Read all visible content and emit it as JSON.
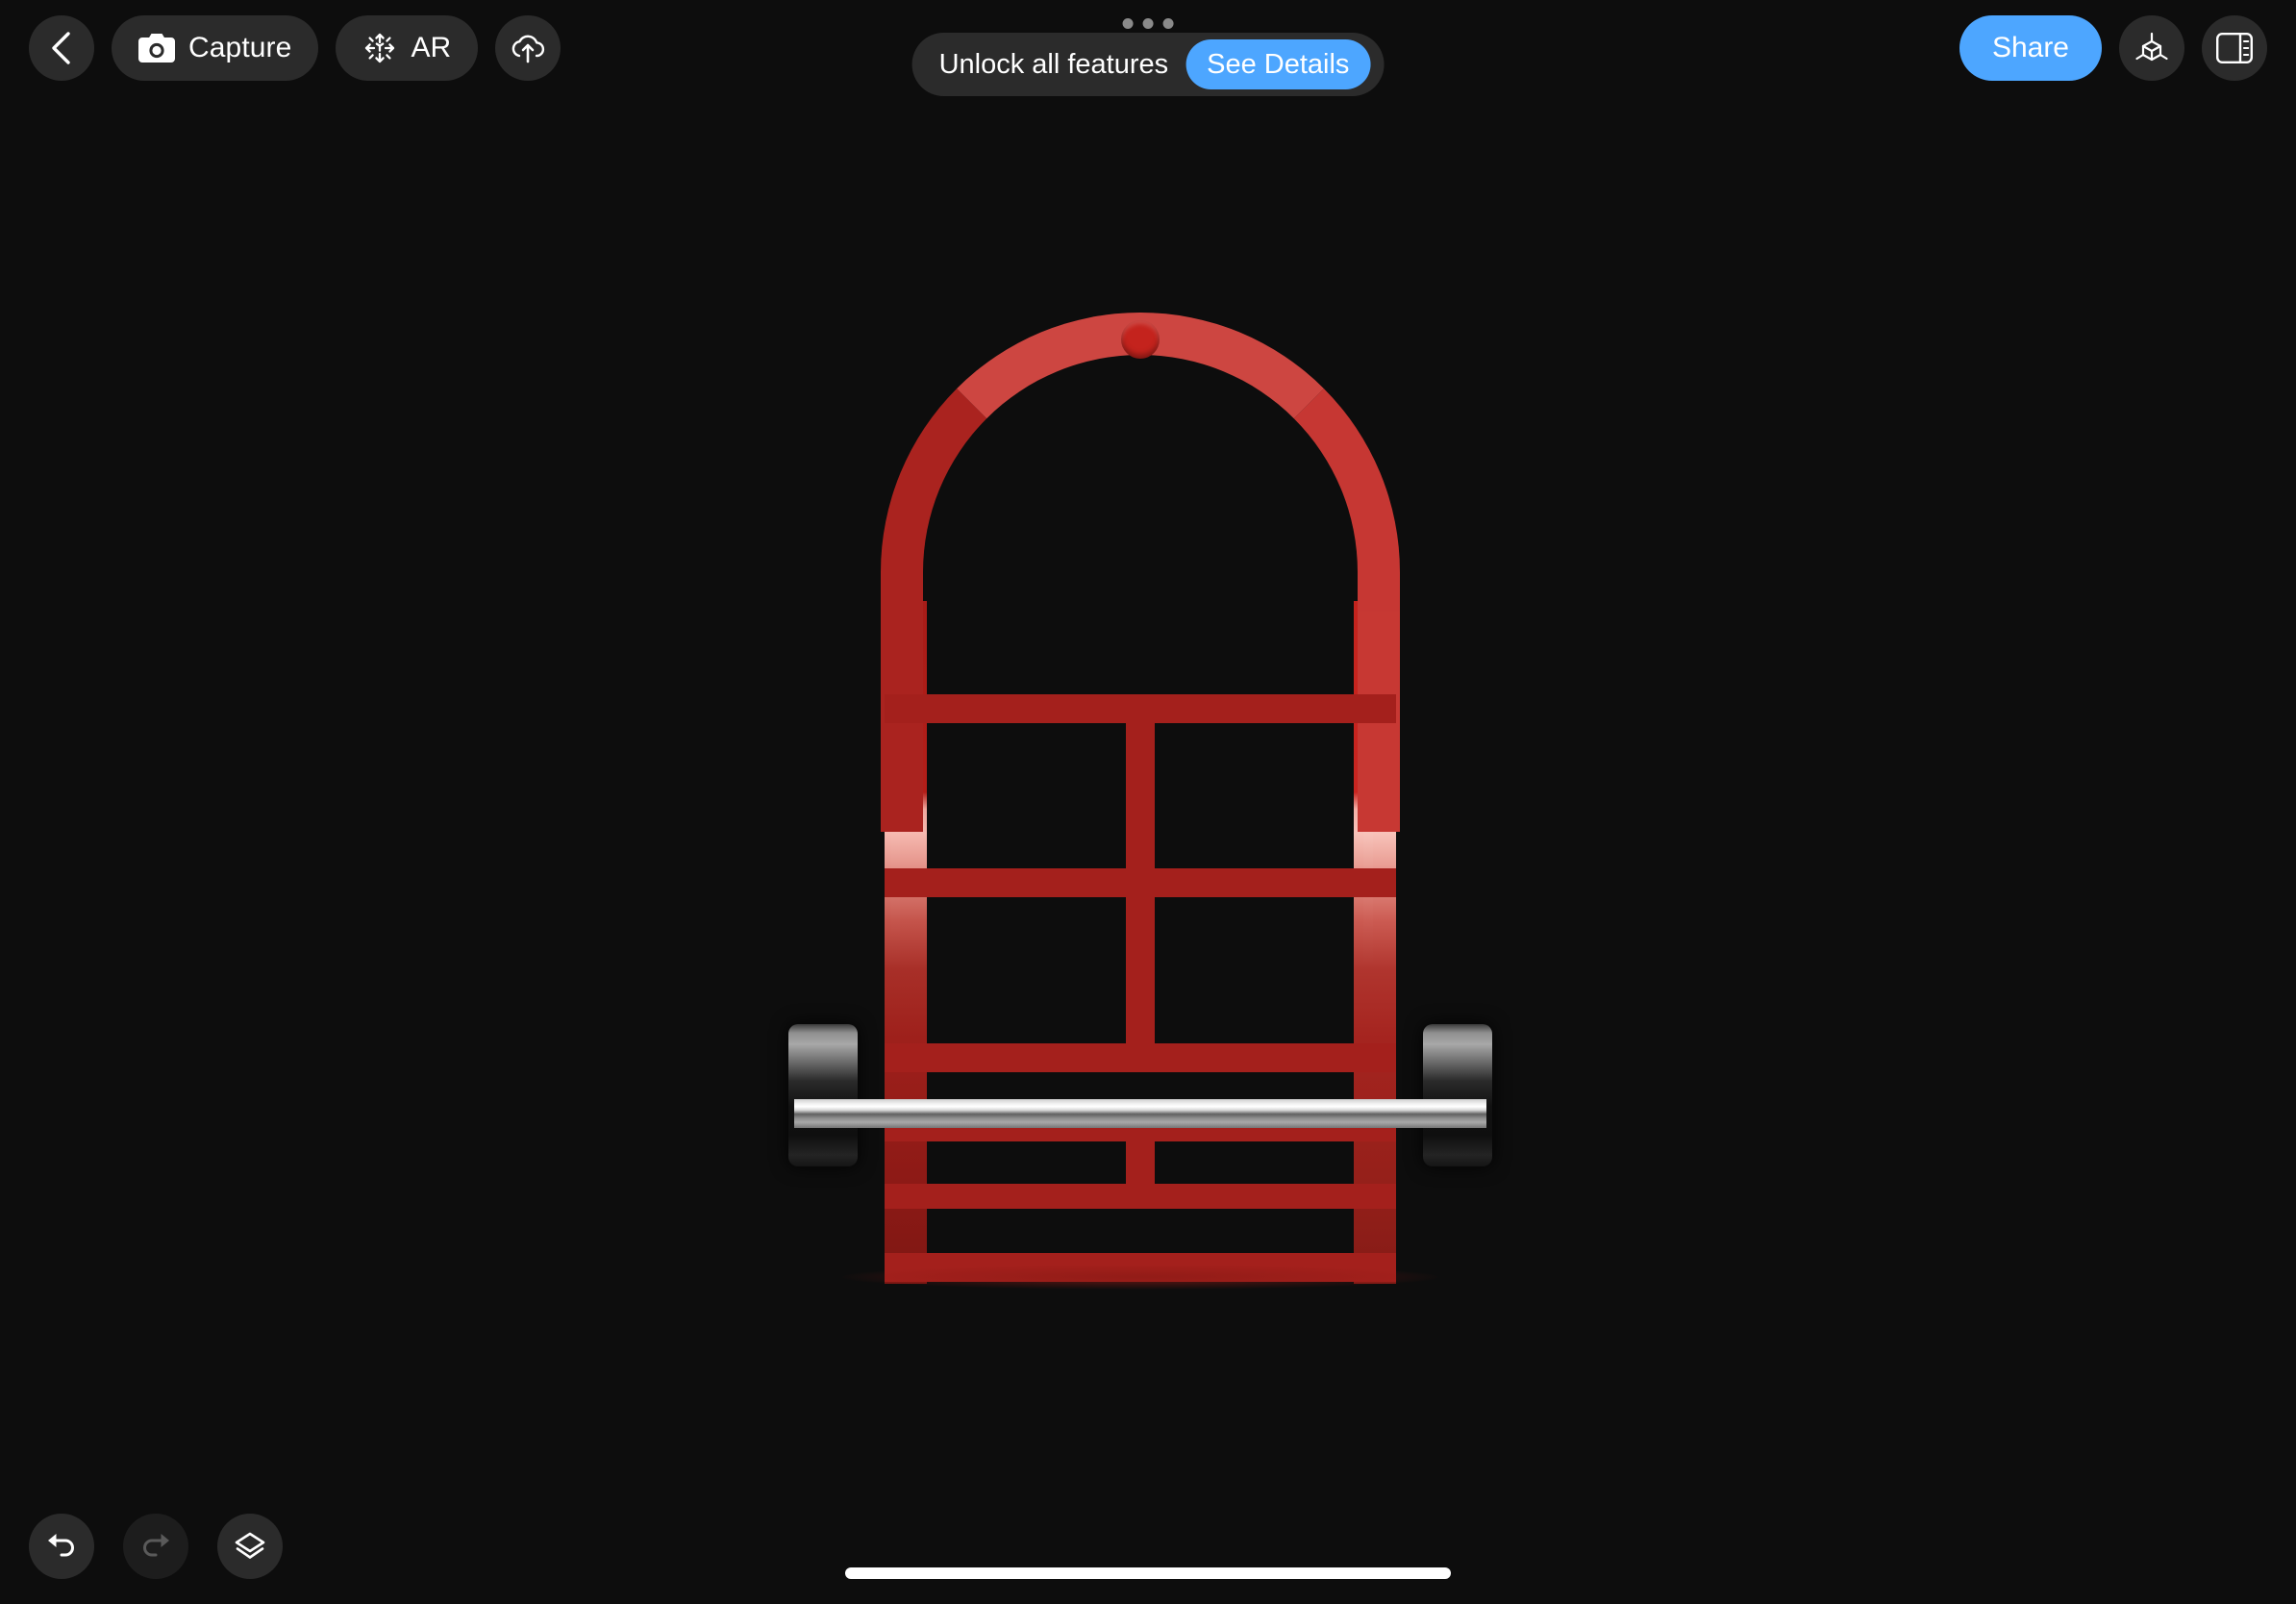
{
  "app": {
    "background_color": "#0d0d0d",
    "accent_color": "#4da6ff",
    "control_bg_color": "#2b2b2b"
  },
  "toolbar_left": {
    "back_icon": "chevron-left-icon",
    "capture": {
      "label": "Capture",
      "icon": "camera-icon"
    },
    "ar": {
      "label": "AR",
      "icon": "ar-cube-arrows-icon"
    },
    "upload": {
      "icon": "cloud-upload-icon"
    }
  },
  "banner": {
    "page_dots": 3,
    "message": "Unlock all features",
    "cta_label": "See Details"
  },
  "toolbar_right": {
    "share_label": "Share",
    "model_icon": "3d-cube-axis-icon",
    "panel_icon": "sidebar-panel-icon"
  },
  "bottom_controls": {
    "undo": {
      "icon": "undo-arrow-icon",
      "enabled": true
    },
    "redo": {
      "icon": "redo-arrow-icon",
      "enabled": false
    },
    "layers": {
      "icon": "layers-stack-icon",
      "enabled": true
    }
  },
  "system": {
    "home_indicator": "home-indicator-bar"
  },
  "viewport": {
    "model_name": "hand-truck-dolly",
    "model_primary_color": "#c4231d",
    "model_accent_color": "#f6b9b0",
    "wheel_color": "#2a2a2a",
    "axle_color": "#e8e8e8"
  }
}
